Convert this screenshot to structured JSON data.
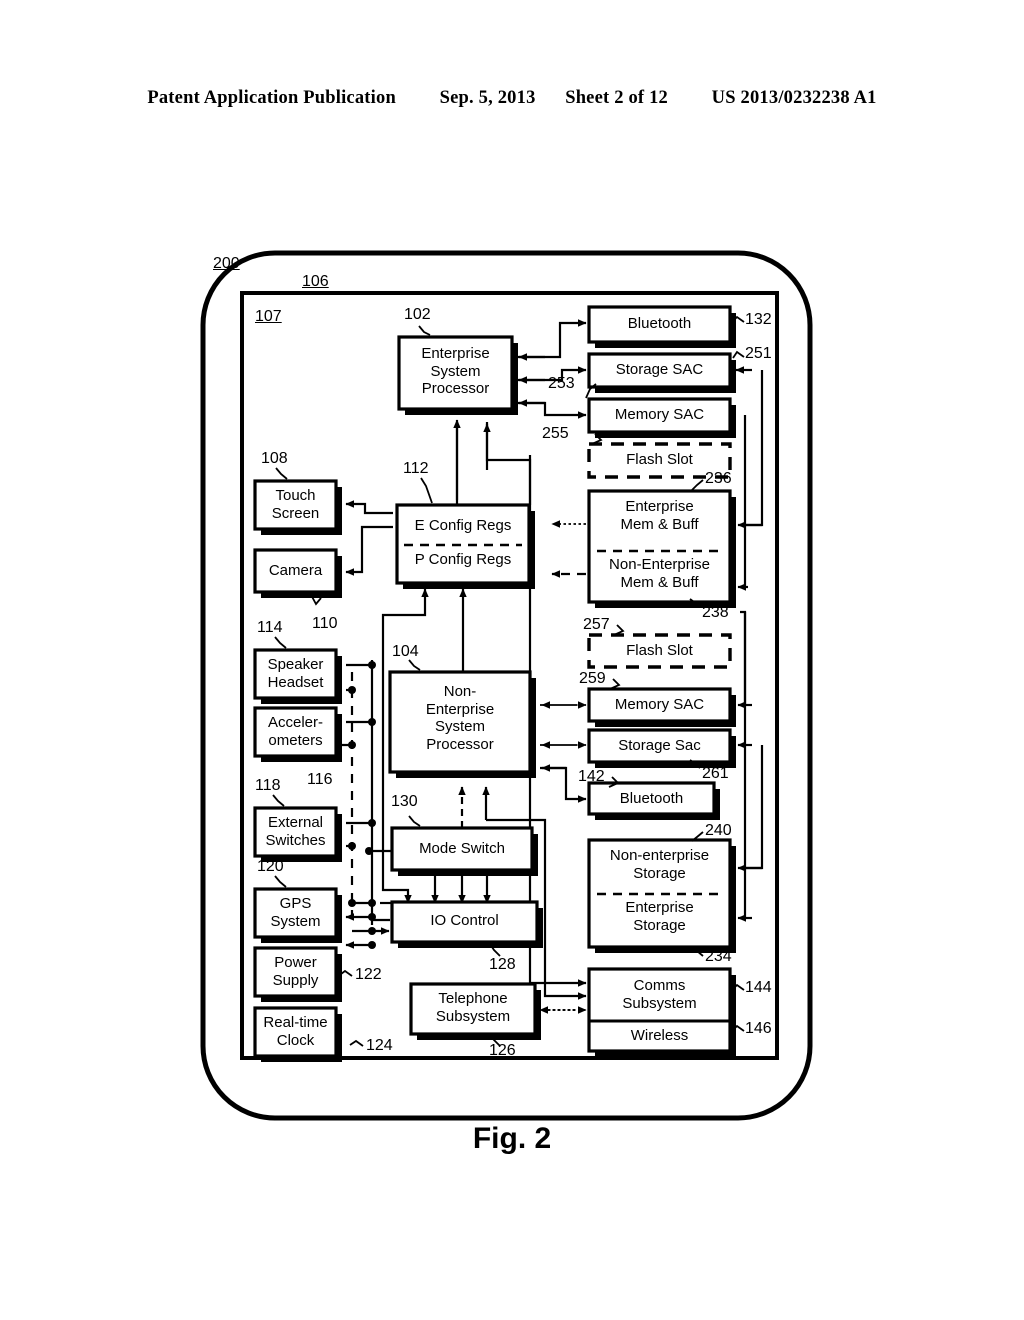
{
  "header": {
    "publication": "Patent Application Publication",
    "date": "Sep. 5, 2013",
    "sheet": "Sheet 2 of 12",
    "patent_number": "US 2013/0232238 A1"
  },
  "figure": {
    "caption": "Fig. 2",
    "device_ref": "200",
    "housing_ref": "106",
    "interior_ref": "107"
  },
  "boxes": {
    "enterprise_system_processor": {
      "label": "Enterprise\nSystem\nProcessor",
      "ref": "102"
    },
    "non_enterprise_system_processor": {
      "label": "Non-\nEnterprise\nSystem\nProcessor",
      "ref": "104"
    },
    "config_regs": {
      "label_top": "E Config Regs",
      "label_bottom": "P Config Regs",
      "ref": "112"
    },
    "touch_screen": {
      "label": "Touch\nScreen",
      "ref": "108"
    },
    "camera": {
      "label": "Camera",
      "ref": "110"
    },
    "speaker_headset": {
      "label": "Speaker\nHeadset",
      "ref": "114"
    },
    "accelerometers": {
      "label": "Acceler-\nometers",
      "ref": "116"
    },
    "external_switches": {
      "label": "External\nSwitches",
      "ref": "118"
    },
    "gps_system": {
      "label": "GPS\nSystem",
      "ref": "120"
    },
    "power_supply": {
      "label": "Power\nSupply",
      "ref": "122"
    },
    "real_time_clock": {
      "label": "Real-time\nClock",
      "ref": "124"
    },
    "mode_switch": {
      "label": "Mode Switch",
      "ref": "130"
    },
    "io_control": {
      "label": "IO Control",
      "ref": "128"
    },
    "telephone_subsystem": {
      "label": "Telephone\nSubsystem",
      "ref": "126"
    },
    "bluetooth_enterprise": {
      "label": "Bluetooth",
      "ref": "132"
    },
    "storage_sac_enterprise": {
      "label": "Storage SAC",
      "ref": "251"
    },
    "memory_sac_enterprise": {
      "label": "Memory SAC",
      "ref": "253"
    },
    "flash_slot_enterprise": {
      "label": "Flash Slot",
      "ref": "255"
    },
    "mem_buff": {
      "label_top": "Enterprise\nMem & Buff",
      "label_bottom": "Non-Enterprise\nMem & Buff",
      "ref_top": "236",
      "ref_bottom": "238"
    },
    "flash_slot_non_enterprise": {
      "label": "Flash Slot",
      "ref": "257"
    },
    "memory_sac_non_enterprise": {
      "label": "Memory SAC",
      "ref": "259"
    },
    "storage_sac_non_enterprise": {
      "label": "Storage Sac",
      "ref": "261"
    },
    "bluetooth_non_enterprise": {
      "label": "Bluetooth",
      "ref": "142"
    },
    "storage": {
      "label_top": "Non-enterprise\nStorage",
      "label_bottom": "Enterprise\nStorage",
      "ref_top": "240",
      "ref_bottom": "234"
    },
    "comms_subsystem": {
      "label": "Comms\nSubsystem",
      "ref": "144"
    },
    "wireless": {
      "label": "Wireless",
      "ref": "146"
    }
  }
}
